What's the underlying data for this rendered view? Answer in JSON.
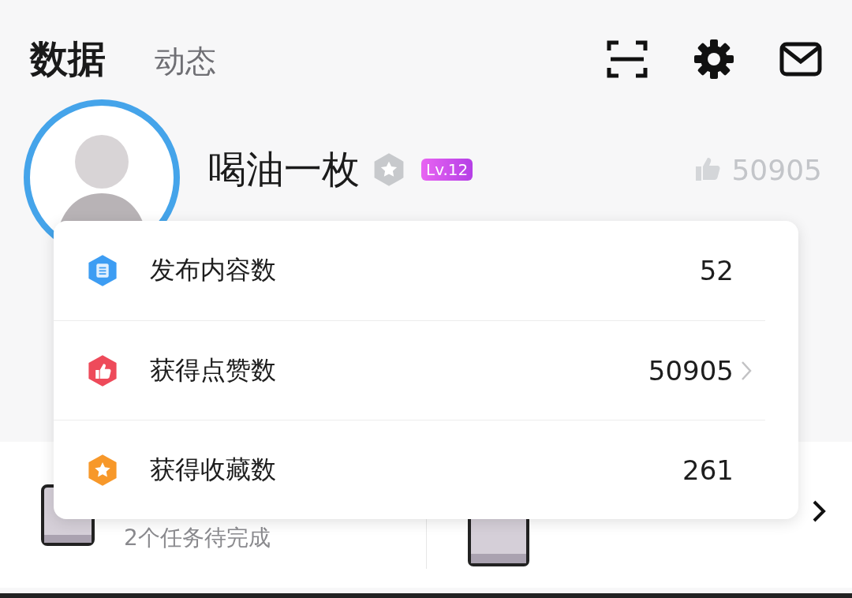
{
  "tabs": [
    {
      "label": "数据",
      "selected": true
    },
    {
      "label": "动态",
      "selected": false
    }
  ],
  "profile": {
    "name": "喝油一枚",
    "level": "Lv.12",
    "likes": "50905"
  },
  "stats": [
    {
      "kind": "posts",
      "label": "发布内容数",
      "value": "52",
      "color": "#3d9df3",
      "arrow": false
    },
    {
      "kind": "likes",
      "label": "获得点赞数",
      "value": "50905",
      "color": "#ee4a5a",
      "arrow": true
    },
    {
      "kind": "favorites",
      "label": "获得收藏数",
      "value": "261",
      "color": "#f7982a",
      "arrow": false
    }
  ],
  "tasks": {
    "subtitle": "2个任务待完成"
  }
}
